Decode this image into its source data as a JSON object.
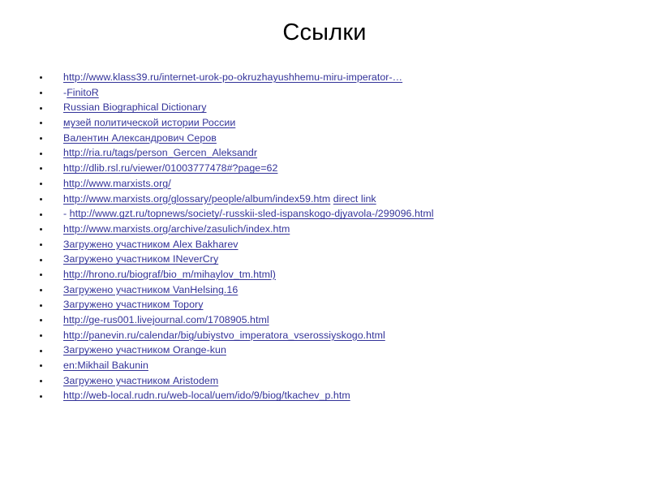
{
  "slide": {
    "title": "Ссылки",
    "accent_color": "#333399",
    "title_color": "#000000",
    "background_color": "#ffffff",
    "bullet_glyph": "•"
  },
  "links": [
    {
      "prefix": "",
      "text": "http://www.klass39.ru/internet-urok-po-okruzhayushhemu-miru-imperator-…",
      "suffix_space": "",
      "suffix": ""
    },
    {
      "prefix": "-",
      "text": "FinitoR",
      "suffix_space": "",
      "suffix": ""
    },
    {
      "prefix": "",
      "text": "Russian Biographical Dictionary",
      "suffix_space": "",
      "suffix": ""
    },
    {
      "prefix": "",
      "text": "музей политической истории России",
      "suffix_space": "",
      "suffix": ""
    },
    {
      "prefix": "",
      "text": "Валентин Александрович Серов",
      "suffix_space": "",
      "suffix": ""
    },
    {
      "prefix": "",
      "text": "http://ria.ru/tags/person_Gercen_Aleksandr",
      "suffix_space": "",
      "suffix": ""
    },
    {
      "prefix": "",
      "text": "http://dlib.rsl.ru/viewer/01003777478#?page=62",
      "suffix_space": "",
      "suffix": ""
    },
    {
      "prefix": "",
      "text": "http://www.marxists.org/",
      "suffix_space": "",
      "suffix": ""
    },
    {
      "prefix": "",
      "text": "http://www.marxists.org/glossary/people/album/index59.htm",
      "suffix_space": " ",
      "suffix": "direct link"
    },
    {
      "prefix": "- ",
      "text": "http://www.gzt.ru/topnews/society/-russkii-sled-ispanskogo-djyavola-/299096.html",
      "suffix_space": "",
      "suffix": ""
    },
    {
      "prefix": "",
      "text": "http://www.marxists.org/archive/zasulich/index.htm",
      "suffix_space": "",
      "suffix": ""
    },
    {
      "prefix": "",
      "text": "Загружено участником Alex Bakharev",
      "suffix_space": "",
      "suffix": ""
    },
    {
      "prefix": "",
      "text": "Загружено участником INeverCry",
      "suffix_space": "",
      "suffix": ""
    },
    {
      "prefix": "",
      "text": "http://hrono.ru/biograf/bio_m/mihaylov_tm.html)",
      "suffix_space": "",
      "suffix": ""
    },
    {
      "prefix": "",
      "text": "Загружено участником VanHelsing.16",
      "suffix_space": "",
      "suffix": ""
    },
    {
      "prefix": "",
      "text": "Загружено участником Topory",
      "suffix_space": "",
      "suffix": ""
    },
    {
      "prefix": "",
      "text": "http://ge-rus001.livejournal.com/1708905.html",
      "suffix_space": "",
      "suffix": ""
    },
    {
      "prefix": "",
      "text": "http://panevin.ru/calendar/big/ubiystvo_imperatora_vserossiyskogo.html",
      "suffix_space": "",
      "suffix": ""
    },
    {
      "prefix": "",
      "text": "Загружено участником Orange-kun",
      "suffix_space": "",
      "suffix": ""
    },
    {
      "prefix": "",
      "text": "en:Mikhail Bakunin",
      "suffix_space": "",
      "suffix": ""
    },
    {
      "prefix": "",
      "text": "Загружено участником Aristodem",
      "suffix_space": "",
      "suffix": ""
    },
    {
      "prefix": "",
      "text": "http://web-local.rudn.ru/web-local/uem/ido/9/biog/tkachev_p.htm",
      "suffix_space": "",
      "suffix": ""
    }
  ]
}
